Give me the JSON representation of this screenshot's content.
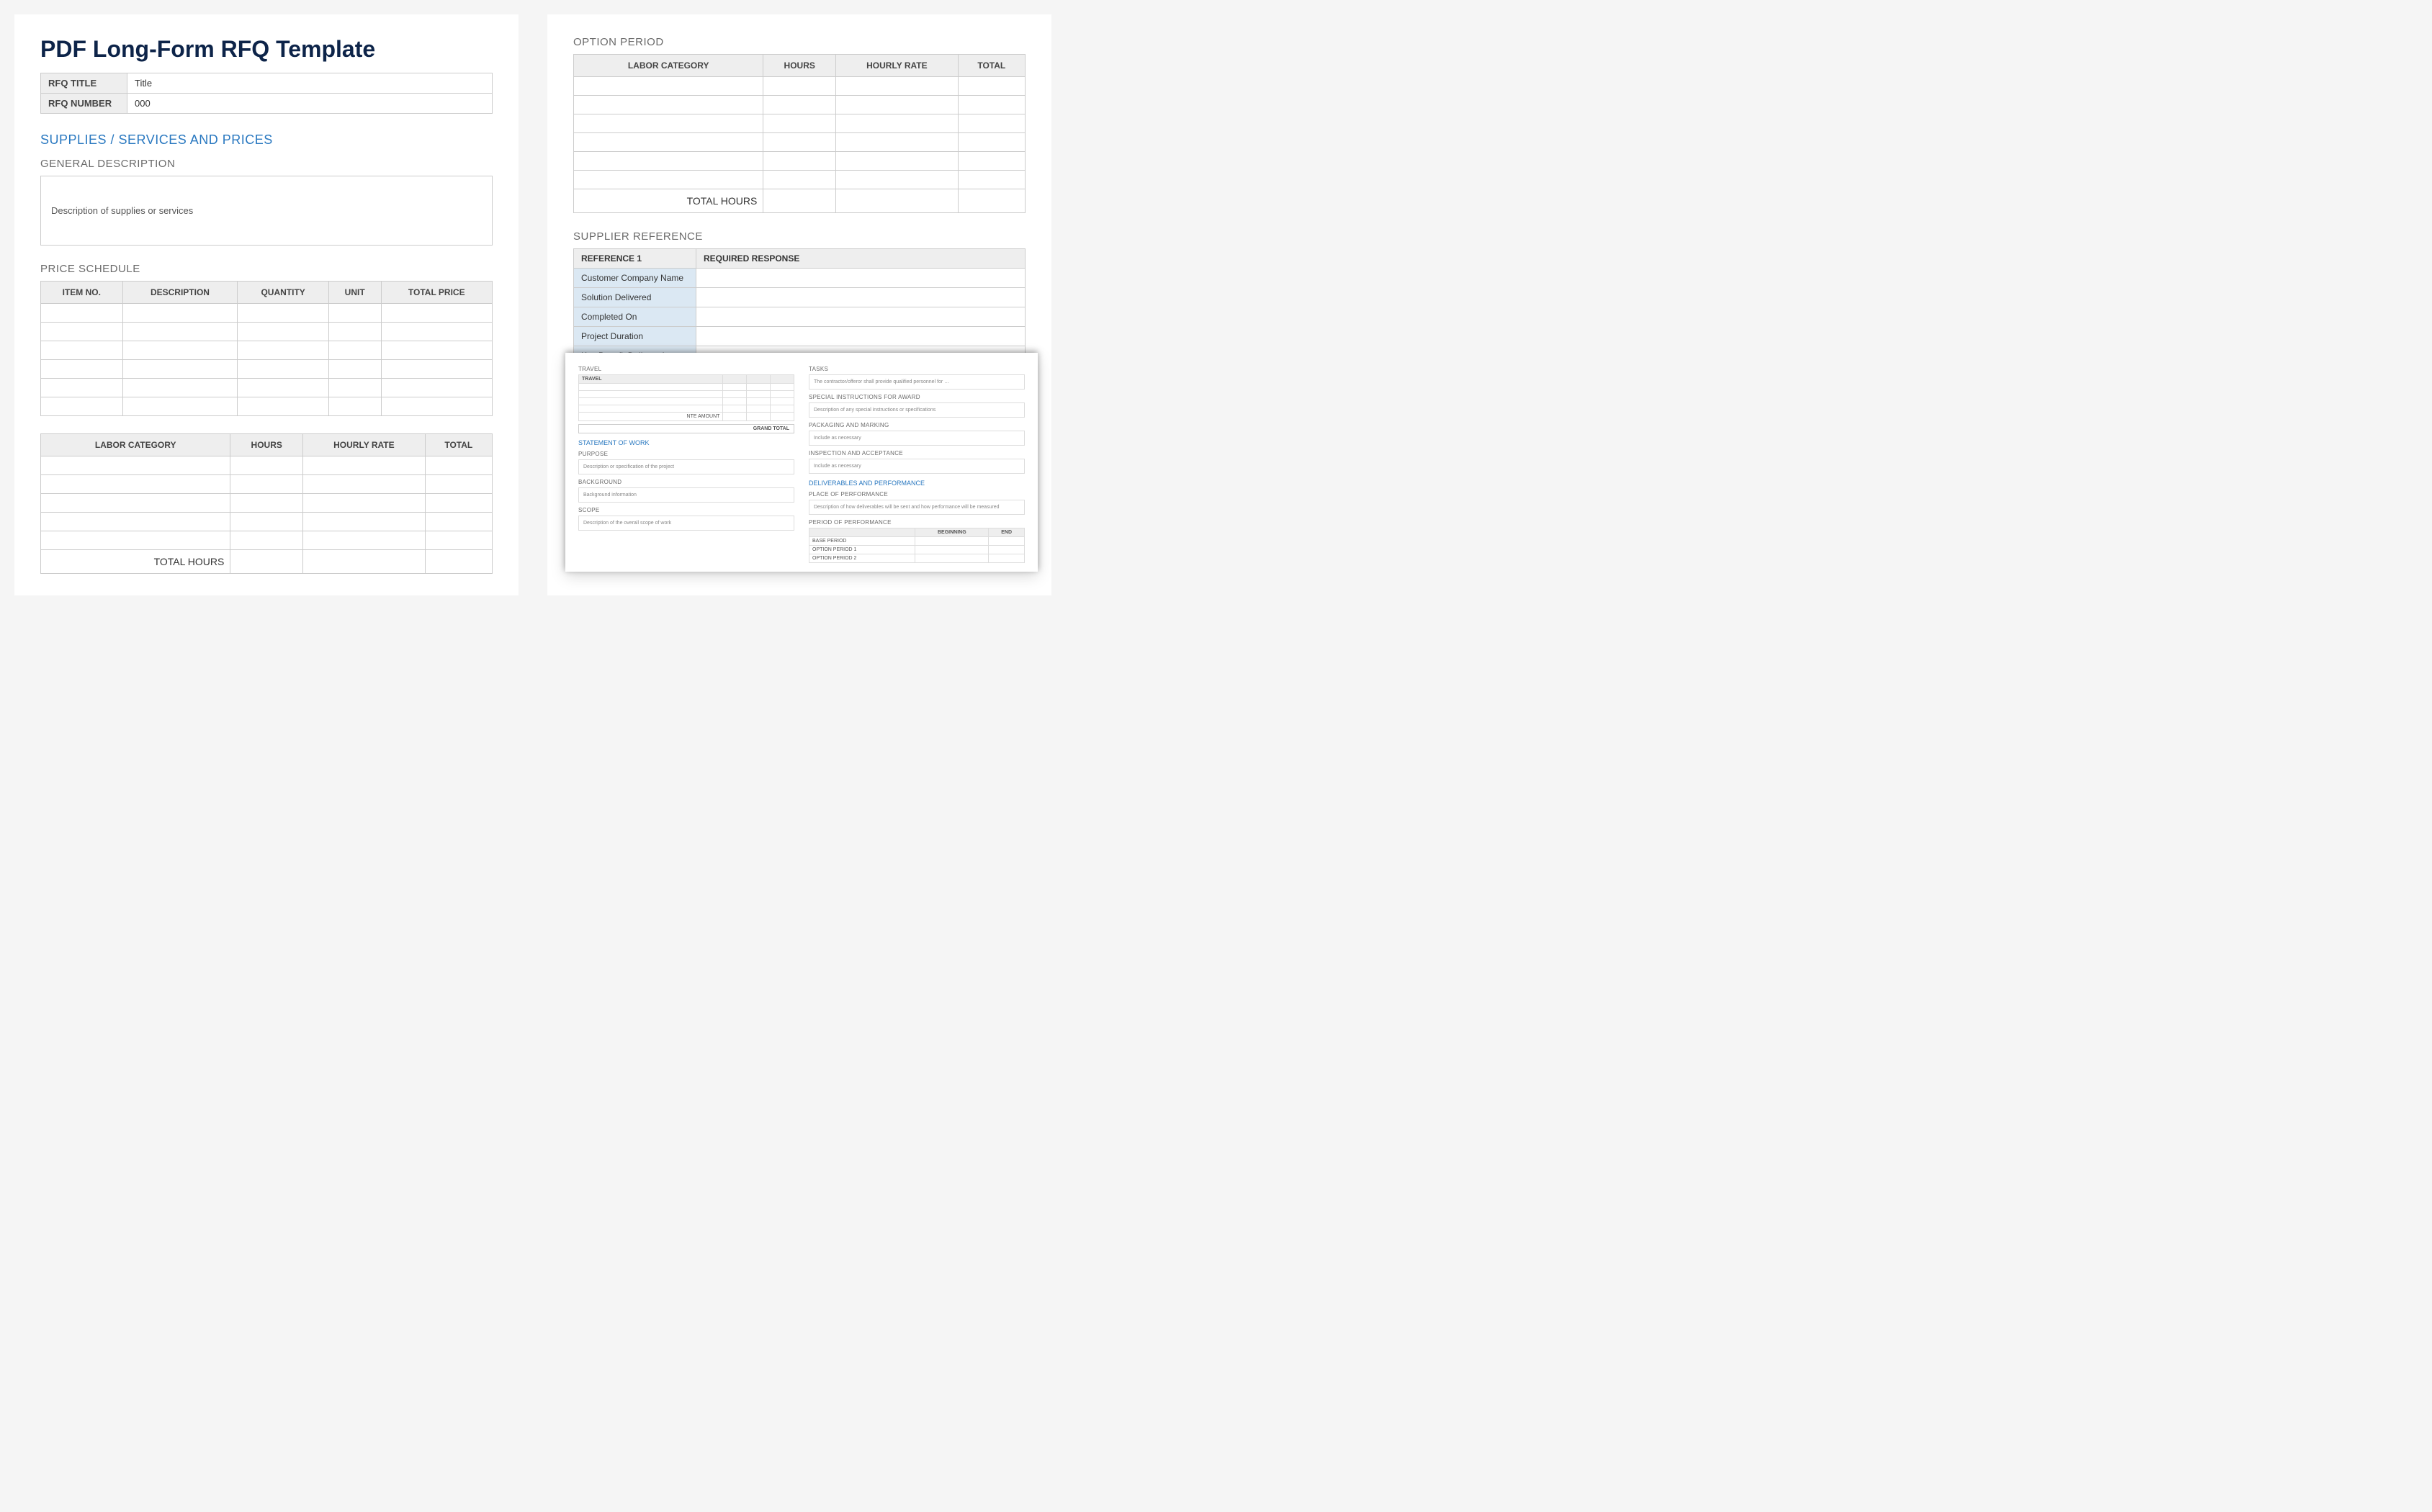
{
  "doc_title": "PDF Long-Form RFQ Template",
  "meta": {
    "rfq_title_label": "RFQ TITLE",
    "rfq_title_value": "Title",
    "rfq_number_label": "RFQ NUMBER",
    "rfq_number_value": "000"
  },
  "section_supplies": "SUPPLIES / SERVICES AND PRICES",
  "section_general_desc": "GENERAL DESCRIPTION",
  "general_desc_text": "Description of supplies or services",
  "section_price_schedule": "PRICE SCHEDULE",
  "price_headers": [
    "ITEM NO.",
    "DESCRIPTION",
    "QUANTITY",
    "UNIT",
    "TOTAL PRICE"
  ],
  "labor_headers": [
    "LABOR CATEGORY",
    "HOURS",
    "HOURLY RATE",
    "TOTAL"
  ],
  "total_hours_label": "TOTAL HOURS",
  "section_option_period": "OPTION PERIOD",
  "section_supplier_ref": "SUPPLIER REFERENCE",
  "ref_header1": "REFERENCE 1",
  "ref_header2": "REQUIRED RESPONSE",
  "ref_rows": [
    "Customer Company Name",
    "Solution Delivered",
    "Completed On",
    "Project Duration",
    "Key Benefit Delivered"
  ],
  "overlay": {
    "travel_header": "TRAVEL",
    "travel_col": "TRAVEL",
    "nte_amount": "NTE AMOUNT",
    "grand_total": "GRAND TOTAL",
    "sow": "STATEMENT OF WORK",
    "purpose": "PURPOSE",
    "purpose_text": "Description or specification of the project",
    "background": "BACKGROUND",
    "background_text": "Background information",
    "scope": "SCOPE",
    "scope_text": "Description of the overall scope of work",
    "tasks": "TASKS",
    "tasks_text": "The contractor/offeror shall provide qualified personnel for …",
    "special": "SPECIAL INSTRUCTIONS FOR AWARD",
    "special_text": "Description of any special instructions or specifications",
    "packaging": "PACKAGING AND MARKING",
    "include_text": "Include as necessary",
    "inspection": "INSPECTION AND ACCEPTANCE",
    "deliverables": "DELIVERABLES AND PERFORMANCE",
    "place": "PLACE OF PERFORMANCE",
    "place_text": "Description of how deliverables will be sent and how performance will be measured",
    "period": "PERIOD OF PERFORMANCE",
    "period_headers": [
      "",
      "BEGINNING",
      "END"
    ],
    "period_rows": [
      "BASE PERIOD",
      "OPTION PERIOD 1",
      "OPTION PERIOD 2"
    ]
  }
}
